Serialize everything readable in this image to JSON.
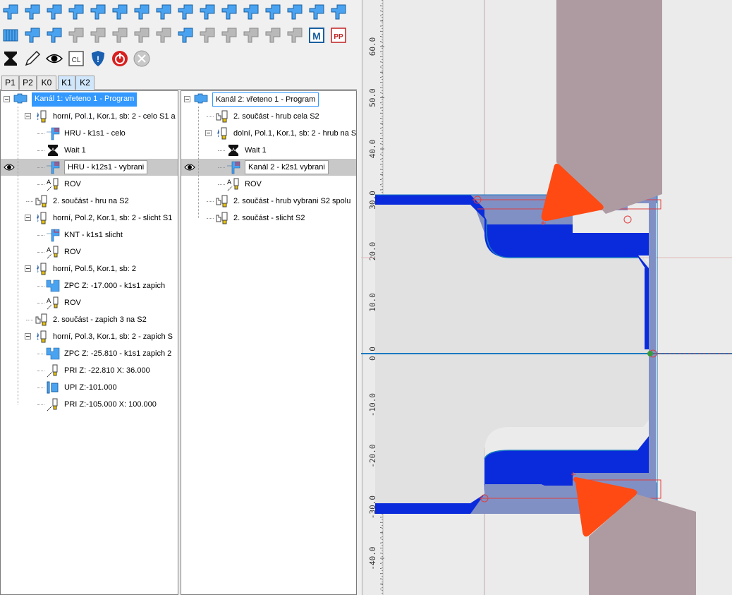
{
  "toolbar": {
    "rows": [
      [
        "program-icon",
        "spindle-icon",
        "axes-icon",
        "rotate-icon",
        "insert-icon",
        "wave-icon",
        "cycle-icon",
        "list-icon",
        "turn-contour-icon",
        "flag-icon",
        "groove-icon",
        "step-icon",
        "tool-right-icon",
        "shaft-icon",
        "bar-icon",
        "undo-icon"
      ],
      [
        "thread-icon",
        "polyline-icon",
        "dotted-arrow-icon",
        "panel-icon",
        "panel2-icon",
        "panel3-icon",
        "panel4-icon",
        "spiral-icon",
        "matrix-icon",
        "drill-grid-icon",
        "copy-icon",
        "copy2-icon",
        "transfer-icon",
        "keypad-icon",
        "m-code-icon",
        "pp-icon"
      ],
      [
        "hourglass-icon",
        "pencil-icon",
        "eye-icon",
        "cl-icon",
        "shield-icon",
        "power-icon",
        "cancel-icon"
      ]
    ],
    "labels": {
      "m": "M",
      "pp": "PP",
      "cl": "CL",
      "shield": "!"
    }
  },
  "tabs": [
    "P1",
    "P2",
    "K0",
    "K1",
    "K2"
  ],
  "tree1": [
    {
      "label": "Kanál 1: vřeteno 1 - Program",
      "icon": "channel-icon"
    },
    {
      "label": "horní, Pol.1, Kor.1, sb: 2 - celo S1 a",
      "icon": "tool-icon"
    },
    {
      "label": "HRU - k1s1 - celo",
      "icon": "roughing-icon"
    },
    {
      "label": "Wait 1",
      "icon": "wait-icon"
    },
    {
      "label": "HRU - k12s1 - vybrani",
      "icon": "roughing-icon"
    },
    {
      "label": "ROV",
      "icon": "rov-icon"
    },
    {
      "label": "2. součást - hru na S2",
      "icon": "part-icon"
    },
    {
      "label": "horní, Pol.2, Kor.1, sb: 2 - slicht S1",
      "icon": "tool-icon"
    },
    {
      "label": "KNT - k1s1 slicht",
      "icon": "contour-icon"
    },
    {
      "label": "ROV",
      "icon": "rov-icon"
    },
    {
      "label": "horní, Pol.5, Kor.1, sb: 2",
      "icon": "tool-icon"
    },
    {
      "label": "ZPC  Z: -17.000 - k1s1 zapich",
      "icon": "groove-icon"
    },
    {
      "label": "ROV",
      "icon": "rov-icon"
    },
    {
      "label": "2. součást - zapich 3 na S2",
      "icon": "part-icon"
    },
    {
      "label": "horní, Pol.3, Kor.1, sb: 2 - zapich S",
      "icon": "tool-icon"
    },
    {
      "label": "ZPC  Z: -25.810 - k1s1 zapich 2",
      "icon": "groove-icon"
    },
    {
      "label": "PRI  Z: -22.810  X:  36.000",
      "icon": "linear-icon"
    },
    {
      "label": "UPI  Z:-101.000",
      "icon": "clamp-icon"
    },
    {
      "label": "PRI  Z:-105.000  X: 100.000",
      "icon": "linear-icon"
    }
  ],
  "tree2": [
    {
      "label": "Kanál 2: vřeteno 1 - Program",
      "icon": "channel-icon"
    },
    {
      "label": "2. součást - hrub cela S2",
      "icon": "part-icon"
    },
    {
      "label": "dolní, Pol.1, Kor.1, sb: 2 - hrub na S",
      "icon": "tool-icon"
    },
    {
      "label": "Wait 1",
      "icon": "wait-icon"
    },
    {
      "label": "Kanál 2 - k2s1 vybrani",
      "icon": "roughing-icon"
    },
    {
      "label": "ROV",
      "icon": "rov-icon"
    },
    {
      "label": "2. součást - hrub vybrani S2 spolu",
      "icon": "part-icon"
    },
    {
      "label": "2. součást - slicht S2",
      "icon": "part-icon"
    }
  ],
  "sim": {
    "ruler_labels": [
      "60.0",
      "50.0",
      "40.0",
      "30.0",
      "20.0",
      "10.0",
      "0.0",
      "-10.0",
      "-20.0",
      "-30.0",
      "-40.0"
    ],
    "colors": {
      "background": "#ebebeb",
      "stock": "#e1e1e1",
      "material": "#0a2bdc",
      "cut": "#8190c4",
      "tool": "#ae9ba2",
      "insert": "#ff4a14",
      "path": "#e04040"
    }
  }
}
